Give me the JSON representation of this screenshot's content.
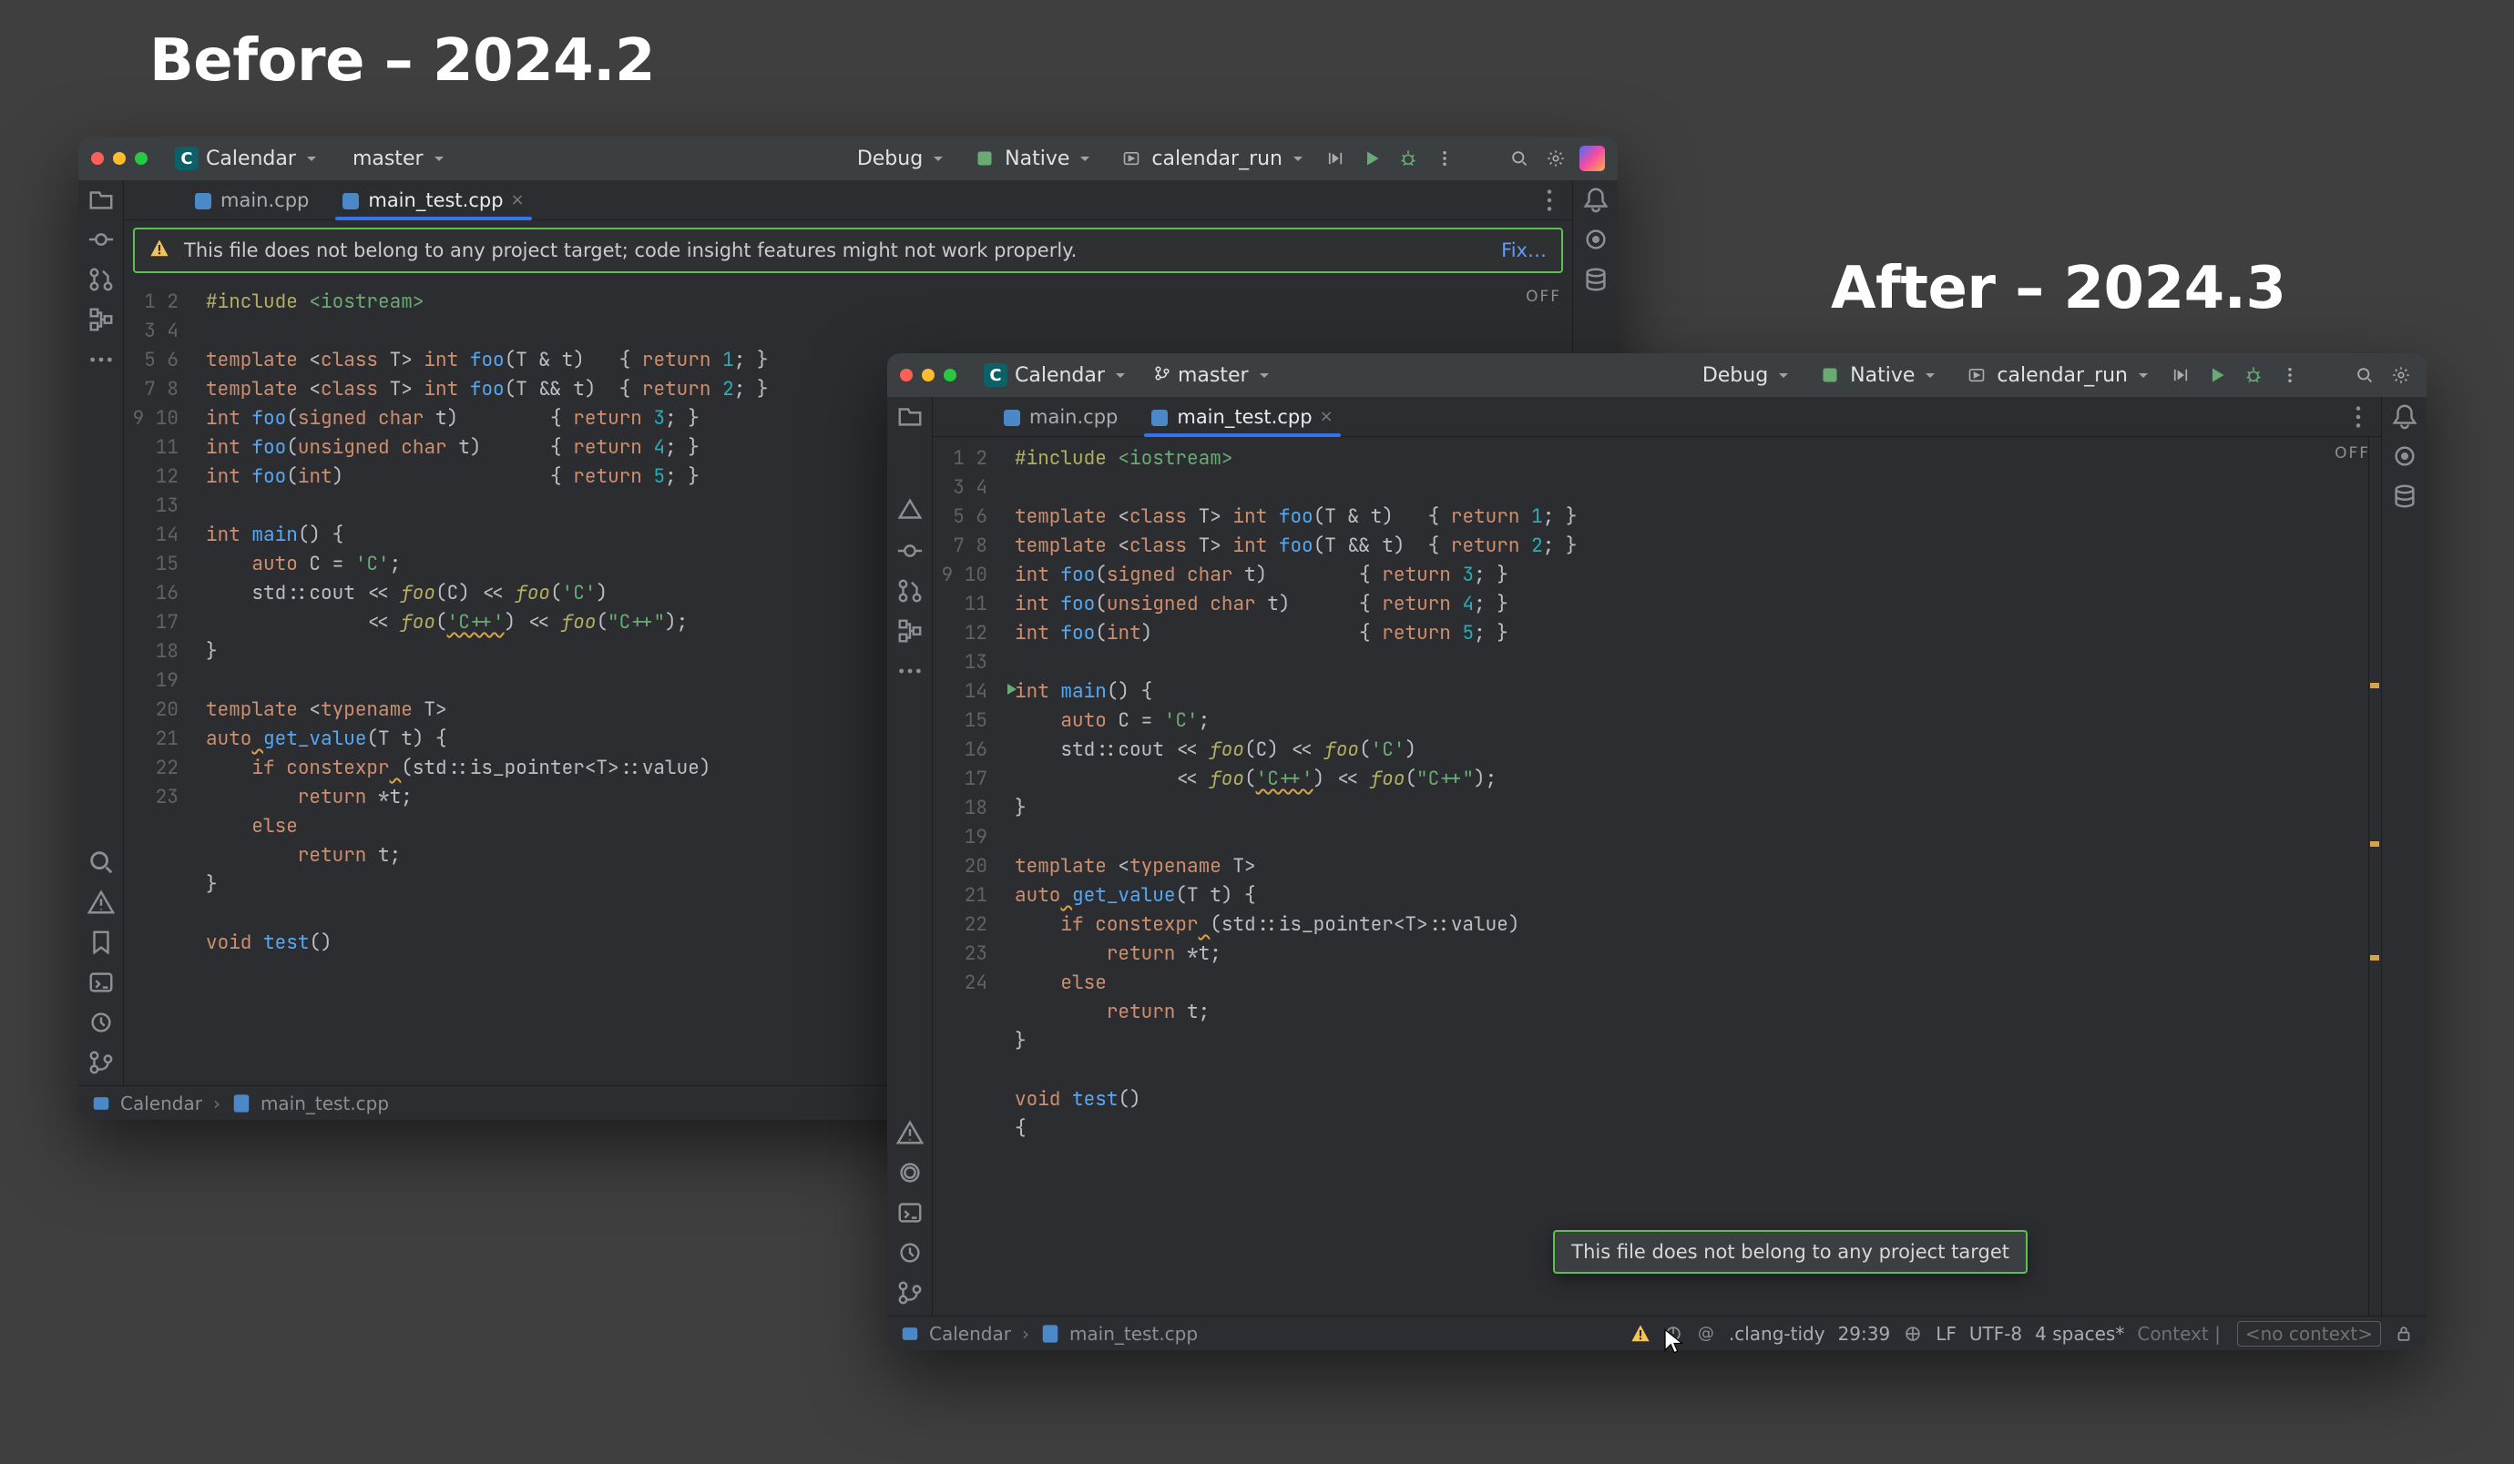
{
  "headings": {
    "before": "Before – 2024.2",
    "after": "After – 2024.3"
  },
  "project": {
    "badge_letter": "C",
    "name": "Calendar",
    "branch": "master",
    "config": "Debug",
    "target": "Native",
    "run_config": "calendar_run"
  },
  "tabs": {
    "main": "main.cpp",
    "test": "main_test.cpp"
  },
  "banner": {
    "text": "This file does not belong to any project target; code insight features might not work properly.",
    "fix_label": "Fix…"
  },
  "tooltip_after": "This file does not belong to any project target",
  "editor_flag": "OFF",
  "breadcrumb": {
    "project": "Calendar",
    "file": "main_test.cpp"
  },
  "status_after": {
    "clang": ".clang-tidy",
    "pos": "29:39",
    "eol": "LF",
    "enc": "UTF-8",
    "indent": "4 spaces*",
    "ctx_label": "Context",
    "ctx_value": "<no context>"
  },
  "code_lines_before": 23,
  "code_lines_after": 24,
  "code_tokens": [
    [
      {
        "t": "pp",
        "v": "#include"
      },
      {
        "t": "id",
        "v": " "
      },
      {
        "t": "s",
        "v": "<iostream>"
      }
    ],
    [],
    [
      {
        "t": "k",
        "v": "template"
      },
      {
        "t": "id",
        "v": " <"
      },
      {
        "t": "k",
        "v": "class"
      },
      {
        "t": "id",
        "v": " T> "
      },
      {
        "t": "t",
        "v": "int"
      },
      {
        "t": "id",
        "v": " "
      },
      {
        "t": "fn",
        "v": "foo"
      },
      {
        "t": "id",
        "v": "(T & t)   { "
      },
      {
        "t": "k",
        "v": "return"
      },
      {
        "t": "id",
        "v": " "
      },
      {
        "t": "n",
        "v": "1"
      },
      {
        "t": "id",
        "v": "; }"
      }
    ],
    [
      {
        "t": "k",
        "v": "template"
      },
      {
        "t": "id",
        "v": " <"
      },
      {
        "t": "k",
        "v": "class"
      },
      {
        "t": "id",
        "v": " T> "
      },
      {
        "t": "t",
        "v": "int"
      },
      {
        "t": "id",
        "v": " "
      },
      {
        "t": "fn",
        "v": "foo"
      },
      {
        "t": "id",
        "v": "(T && t)  { "
      },
      {
        "t": "k",
        "v": "return"
      },
      {
        "t": "id",
        "v": " "
      },
      {
        "t": "n",
        "v": "2"
      },
      {
        "t": "id",
        "v": "; }"
      }
    ],
    [
      {
        "t": "t",
        "v": "int"
      },
      {
        "t": "id",
        "v": " "
      },
      {
        "t": "fn",
        "v": "foo"
      },
      {
        "t": "id",
        "v": "("
      },
      {
        "t": "t",
        "v": "signed char"
      },
      {
        "t": "id",
        "v": " t)        { "
      },
      {
        "t": "k",
        "v": "return"
      },
      {
        "t": "id",
        "v": " "
      },
      {
        "t": "n",
        "v": "3"
      },
      {
        "t": "id",
        "v": "; }"
      }
    ],
    [
      {
        "t": "t",
        "v": "int"
      },
      {
        "t": "id",
        "v": " "
      },
      {
        "t": "fn",
        "v": "foo"
      },
      {
        "t": "id",
        "v": "("
      },
      {
        "t": "t",
        "v": "unsigned char"
      },
      {
        "t": "id",
        "v": " t)      { "
      },
      {
        "t": "k",
        "v": "return"
      },
      {
        "t": "id",
        "v": " "
      },
      {
        "t": "n",
        "v": "4"
      },
      {
        "t": "id",
        "v": "; }"
      }
    ],
    [
      {
        "t": "t",
        "v": "int"
      },
      {
        "t": "id",
        "v": " "
      },
      {
        "t": "fn",
        "v": "foo"
      },
      {
        "t": "id",
        "v": "("
      },
      {
        "t": "t",
        "v": "int"
      },
      {
        "t": "id",
        "v": ")                  { "
      },
      {
        "t": "k",
        "v": "return"
      },
      {
        "t": "id",
        "v": " "
      },
      {
        "t": "n",
        "v": "5"
      },
      {
        "t": "id",
        "v": "; }"
      }
    ],
    [],
    [
      {
        "t": "t",
        "v": "int"
      },
      {
        "t": "id",
        "v": " "
      },
      {
        "t": "fn",
        "v": "main"
      },
      {
        "t": "id",
        "v": "() {"
      }
    ],
    [
      {
        "t": "id",
        "v": "    "
      },
      {
        "t": "k",
        "v": "auto"
      },
      {
        "t": "id",
        "v": " C = "
      },
      {
        "t": "c",
        "v": "'C'"
      },
      {
        "t": "id",
        "v": ";"
      }
    ],
    [
      {
        "t": "id",
        "v": "    std::cout << "
      },
      {
        "t": "fni",
        "v": "foo"
      },
      {
        "t": "id",
        "v": "(C) << "
      },
      {
        "t": "fni",
        "v": "foo"
      },
      {
        "t": "id",
        "v": "("
      },
      {
        "t": "c",
        "v": "'C'"
      },
      {
        "t": "id",
        "v": ")"
      }
    ],
    [
      {
        "t": "id",
        "v": "              << "
      },
      {
        "t": "fni",
        "v": "foo"
      },
      {
        "t": "id",
        "v": "("
      },
      {
        "t": "chwarn",
        "v": "'C++'"
      },
      {
        "t": "id",
        "v": ") << "
      },
      {
        "t": "fni",
        "v": "foo"
      },
      {
        "t": "id",
        "v": "("
      },
      {
        "t": "s",
        "v": "\"C++\""
      },
      {
        "t": "id",
        "v": ");"
      }
    ],
    [
      {
        "t": "id",
        "v": "}"
      }
    ],
    [],
    [
      {
        "t": "k",
        "v": "template"
      },
      {
        "t": "id",
        "v": " <"
      },
      {
        "t": "k",
        "v": "typename"
      },
      {
        "t": "id",
        "v": " T>"
      }
    ],
    [
      {
        "t": "k",
        "v": "auto"
      },
      {
        "t": "uwarn",
        "v": " "
      },
      {
        "t": "fn",
        "v": "get_value"
      },
      {
        "t": "id",
        "v": "(T t) {"
      }
    ],
    [
      {
        "t": "id",
        "v": "    "
      },
      {
        "t": "k",
        "v": "if"
      },
      {
        "t": "id",
        "v": " "
      },
      {
        "t": "k",
        "v": "constexpr"
      },
      {
        "t": "uwarn",
        "v": " "
      },
      {
        "t": "id",
        "v": "(std::is_pointer<T>::value)"
      }
    ],
    [
      {
        "t": "id",
        "v": "        "
      },
      {
        "t": "k",
        "v": "return"
      },
      {
        "t": "id",
        "v": " *t;"
      }
    ],
    [
      {
        "t": "id",
        "v": "    "
      },
      {
        "t": "k",
        "v": "else"
      }
    ],
    [
      {
        "t": "id",
        "v": "        "
      },
      {
        "t": "k",
        "v": "return"
      },
      {
        "t": "id",
        "v": " t;"
      }
    ],
    [
      {
        "t": "id",
        "v": "}"
      }
    ],
    [],
    [
      {
        "t": "t",
        "v": "void"
      },
      {
        "t": "id",
        "v": " "
      },
      {
        "t": "fn",
        "v": "test"
      },
      {
        "t": "id",
        "v": "()"
      }
    ],
    [
      {
        "t": "id",
        "v": "{"
      }
    ]
  ]
}
